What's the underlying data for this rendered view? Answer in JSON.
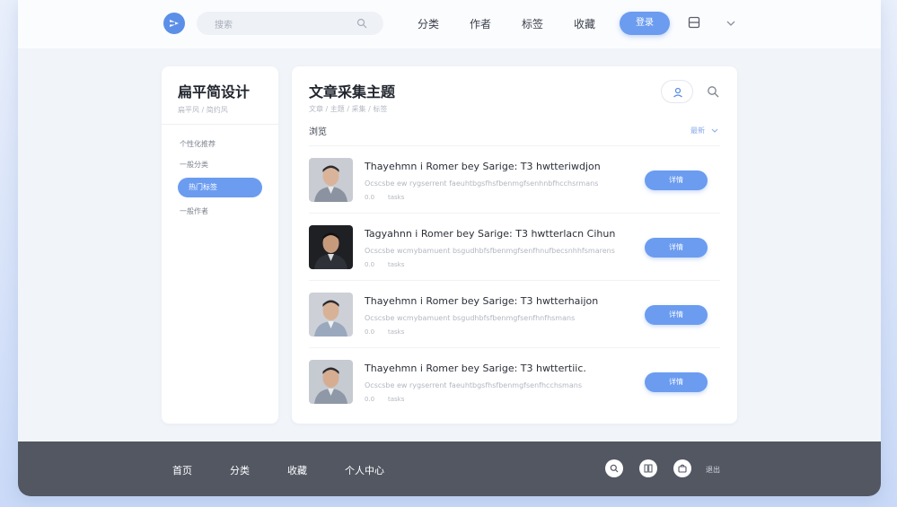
{
  "header": {
    "search_placeholder": "搜索",
    "nav": [
      "分类",
      "作者",
      "标签",
      "收藏"
    ],
    "login_label": "登录"
  },
  "sidebar": {
    "title": "扁平简设计",
    "subtitle": "扁平风 / 简约风",
    "items": [
      {
        "label": "个性化推荐"
      },
      {
        "label": "一般分类"
      },
      {
        "label": "热门标签"
      },
      {
        "label": "一般作者"
      }
    ],
    "active_index": 2
  },
  "main": {
    "title": "文章采集主题",
    "subtitle": "文章 / 主题 / 采集 / 标签",
    "section_label": "浏览",
    "sort_label": "最新",
    "articles": [
      {
        "title": "Thayehmn i Romer bey Sarige: T3 hwtteriwdjon",
        "desc": "Ocscsbe ew rygserrent faeuhtbgsfhsfbenmgfsenhnbfhcchsrmans",
        "meta1": "0.0",
        "meta2": "tasks",
        "button": "详情"
      },
      {
        "title": "Tagyahnn i Romer bey Sarige: T3 hwtterlacn Cihun",
        "desc": "Ocscsbe wcmybamuent bsgudhbfsfbenmgfsenfhnufbecsnhhfsmarens",
        "meta1": "0.0",
        "meta2": "tasks",
        "button": "详情"
      },
      {
        "title": "Thayehmn i Romer bey Sarige: T3 hwtterhaijon",
        "desc": "Ocscsbe wcmybamuent bsgudhbfsfbenmgfsenfhnfhsmans",
        "meta1": "0.0",
        "meta2": "tasks",
        "button": "详情"
      },
      {
        "title": "Thayehmn i Romer bey Sarige: T3 hwttertiic.",
        "desc": "Ocscsbe ew rygserrent faeuhtbgsfhsfbenmgfsenfhcchsmans",
        "meta1": "0.0",
        "meta2": "tasks",
        "button": "详情"
      }
    ]
  },
  "footer": {
    "nav": [
      "首页",
      "分类",
      "收藏",
      "个人中心"
    ],
    "right_text": "退出"
  },
  "colors": {
    "accent": "#6b9cf0",
    "footer_bg": "#525762",
    "logo": "#5b8fe8"
  },
  "icons": [
    "logo-icon",
    "search-icon",
    "message-icon",
    "chevron-down-icon",
    "user-icon",
    "search-icon",
    "home-icon",
    "grid-icon",
    "bag-icon"
  ]
}
